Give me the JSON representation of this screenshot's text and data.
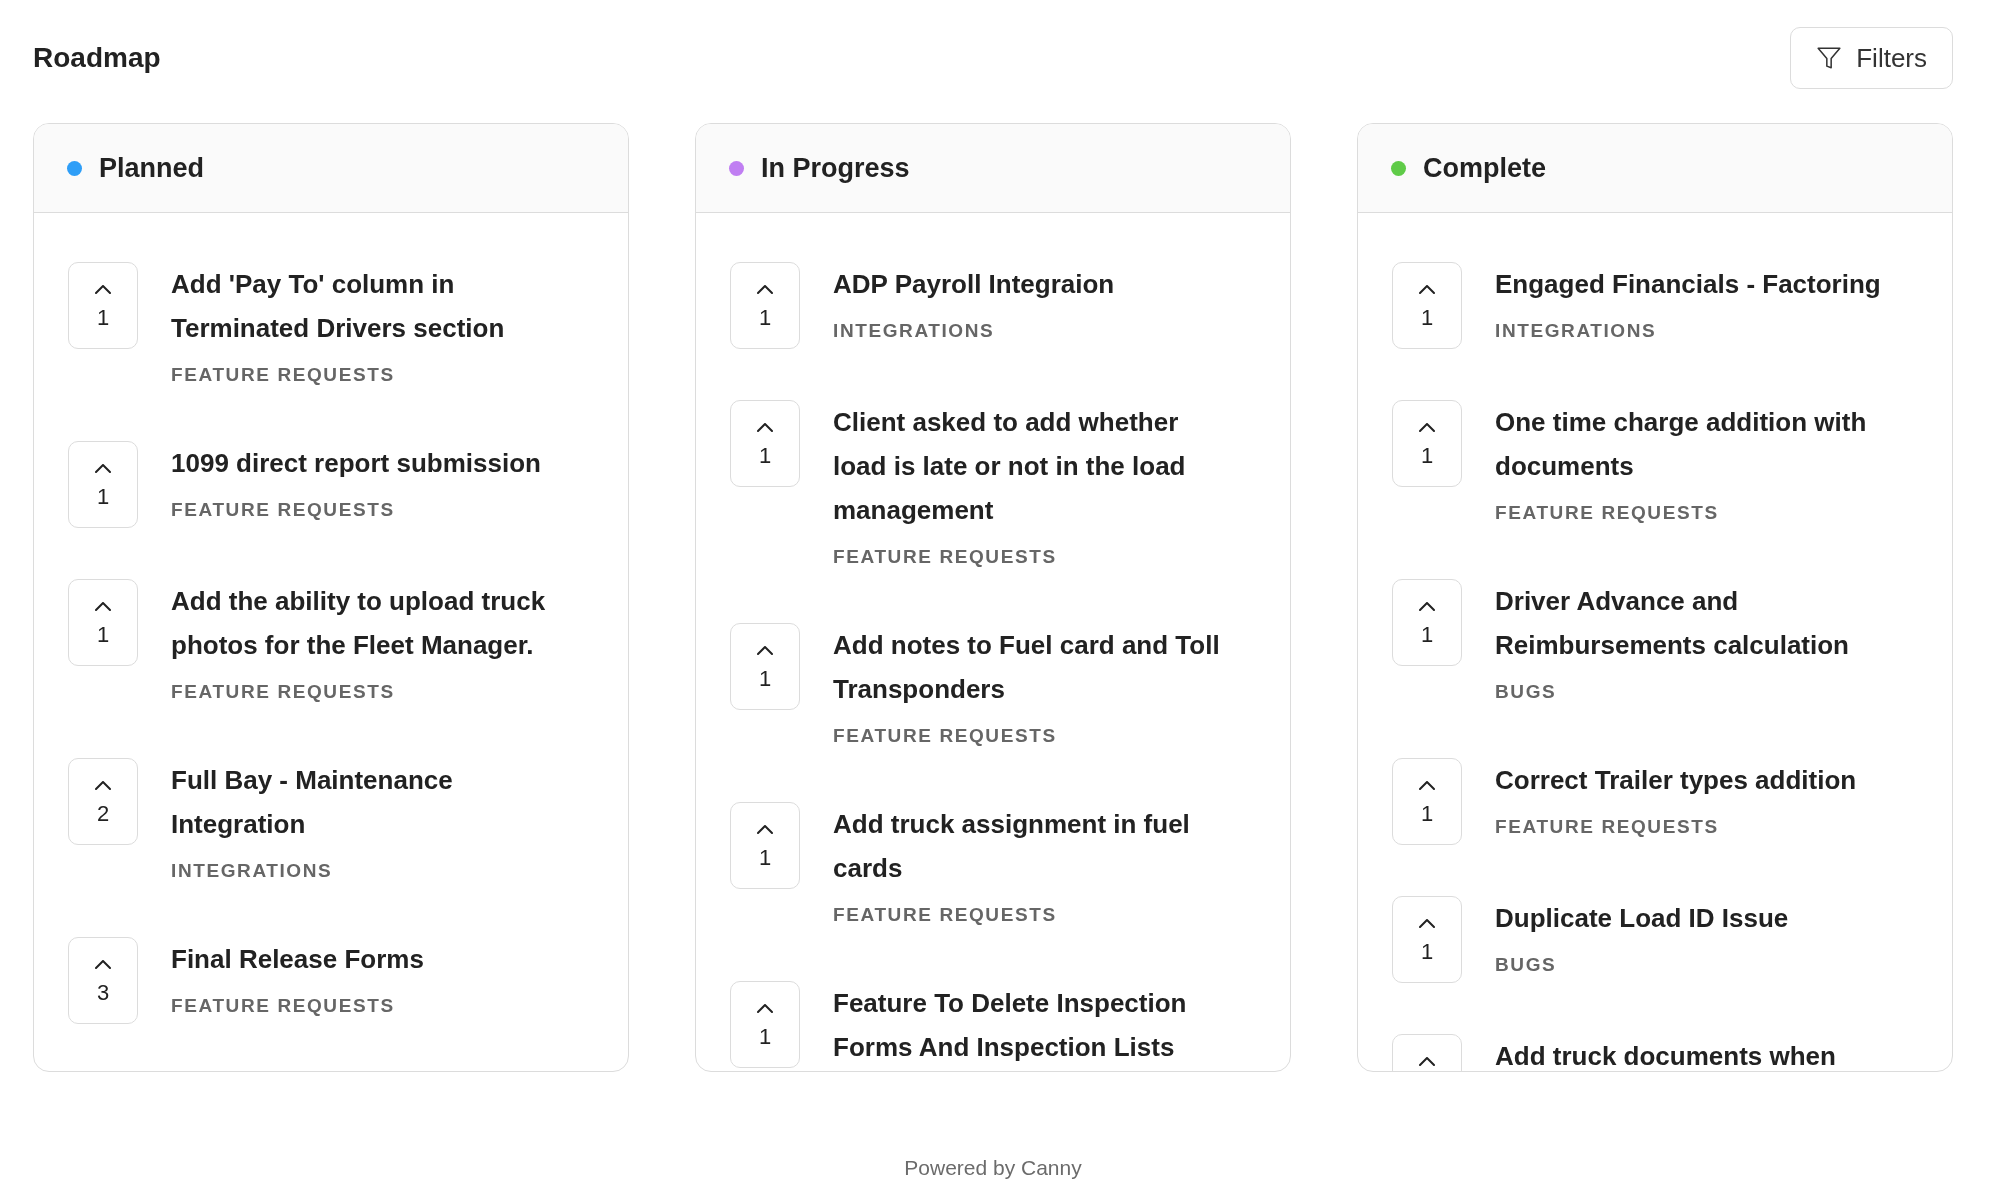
{
  "page": {
    "title": "Roadmap",
    "filters_button": "Filters",
    "footer": "Powered by Canny"
  },
  "columns": [
    {
      "name": "Planned",
      "color": "#2e9ef7",
      "posts": [
        {
          "title": "Add 'Pay To' column in Terminated Drivers section",
          "votes": "1",
          "category": "FEATURE REQUESTS"
        },
        {
          "title": "1099 direct report submission",
          "votes": "1",
          "category": "FEATURE REQUESTS"
        },
        {
          "title": "Add the ability to upload truck photos for the Fleet Manager.",
          "votes": "1",
          "category": "FEATURE REQUESTS"
        },
        {
          "title": "Full Bay - Maintenance Integration",
          "votes": "2",
          "category": "INTEGRATIONS"
        },
        {
          "title": "Final Release Forms",
          "votes": "3",
          "category": "FEATURE REQUESTS"
        }
      ]
    },
    {
      "name": "In Progress",
      "color": "#c07ef2",
      "posts": [
        {
          "title": "ADP Payroll Integraion",
          "votes": "1",
          "category": "INTEGRATIONS"
        },
        {
          "title": "Client asked to add whether load is late or not in the load management",
          "votes": "1",
          "category": "FEATURE REQUESTS"
        },
        {
          "title": "Add notes to Fuel card and Toll Transponders",
          "votes": "1",
          "category": "FEATURE REQUESTS"
        },
        {
          "title": "Add truck assignment in fuel cards",
          "votes": "1",
          "category": "FEATURE REQUESTS"
        },
        {
          "title": "Feature To Delete Inspection Forms And Inspection Lists",
          "votes": "1"
        }
      ]
    },
    {
      "name": "Complete",
      "color": "#5fcb48",
      "posts": [
        {
          "title": "Engaged Financials - Factoring",
          "votes": "1",
          "category": "INTEGRATIONS"
        },
        {
          "title": "One time charge addition with documents",
          "votes": "1",
          "category": "FEATURE REQUESTS"
        },
        {
          "title": "Driver Advance and Reimbursements calculation",
          "votes": "1",
          "category": "BUGS"
        },
        {
          "title": "Correct Trailer types addition",
          "votes": "1",
          "category": "FEATURE REQUESTS"
        },
        {
          "title": "Duplicate Load ID Issue",
          "votes": "1",
          "category": "BUGS"
        },
        {
          "title": "Add truck documents when"
        }
      ]
    }
  ]
}
